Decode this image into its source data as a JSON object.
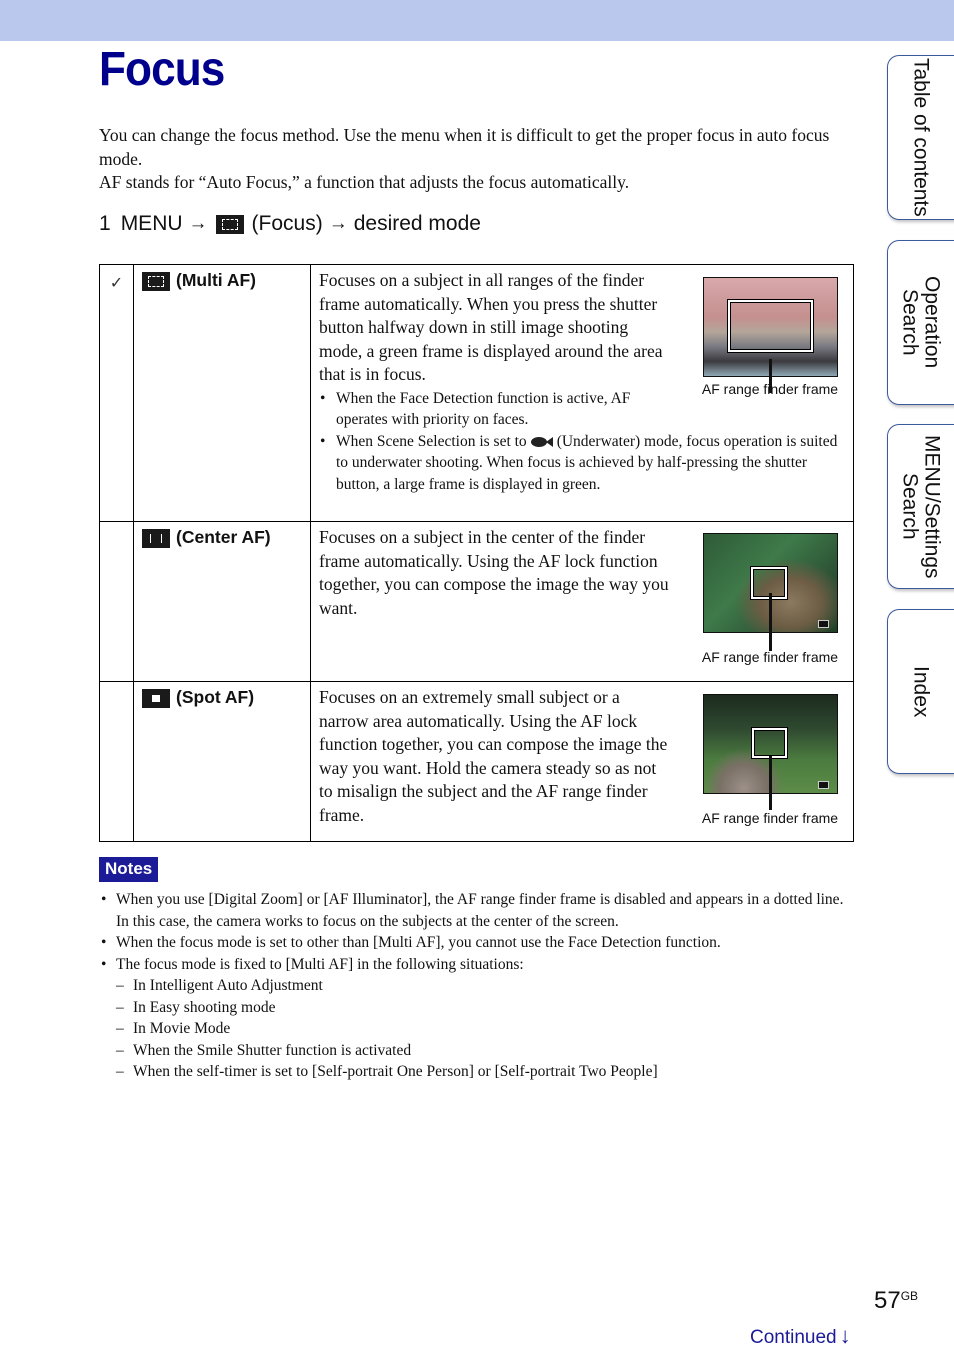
{
  "page": {
    "title": "Focus",
    "intro": [
      "You can change the focus method. Use the menu when it is difficult to get the proper focus in auto focus mode.",
      "AF stands for “Auto Focus,” a function that adjusts the focus automatically."
    ],
    "step": {
      "number": "1",
      "menu": "MENU",
      "arrow": "→",
      "icon": "focus-icon",
      "focus_label": "(Focus)",
      "target": "desired mode"
    }
  },
  "modes": [
    {
      "default_mark": "✓",
      "icon": "multi-af-icon",
      "name": "(Multi AF)",
      "description": "Focuses on a subject in all ranges of the finder frame automatically. When you press the shutter button halfway down in still image shooting mode, a green frame is displayed around the area that is in focus.",
      "bullets": [
        "When the Face Detection function is active, AF operates with priority on faces.",
        {
          "before": "When Scene Selection is set to",
          "icon": "underwater-fish-icon",
          "after": "(Underwater) mode, focus operation is suited to underwater shooting. When focus is achieved by half-pressing the shutter button, a large frame is displayed in green."
        }
      ],
      "figure_caption": "AF range finder frame"
    },
    {
      "default_mark": "",
      "icon": "center-af-icon",
      "name": "(Center AF)",
      "description": "Focuses on a subject in the center of the finder frame automatically. Using the AF lock function together, you can compose the image the way you want.",
      "figure_caption": "AF range finder frame"
    },
    {
      "default_mark": "",
      "icon": "spot-af-icon",
      "name": "(Spot AF)",
      "description": "Focuses on an extremely small subject or a narrow area automatically. Using the AF lock function together, you can compose the image the way you want. Hold the camera steady so as not to misalign the subject and the AF range finder frame.",
      "figure_caption": "AF range finder frame"
    }
  ],
  "notes": {
    "heading": "Notes",
    "items": [
      "When you use [Digital Zoom] or [AF Illuminator], the AF range finder frame is disabled and appears in a dotted line. In this case, the camera works to focus on the subjects at the center of the screen.",
      "When the focus mode is set to other than [Multi AF], you cannot use the Face Detection function.",
      "The focus mode is fixed to [Multi AF] in the following situations:"
    ],
    "situations": [
      "In Intelligent Auto Adjustment",
      "In Easy shooting mode",
      "In Movie Mode",
      "When the Smile Shutter function is activated",
      "When the self-timer is set to [Self-portrait One Person] or [Self-portrait Two People]"
    ]
  },
  "side_tabs": [
    {
      "label": "Table of contents"
    },
    {
      "label": "Operation Search"
    },
    {
      "label": "MENU/Settings Search"
    },
    {
      "label": "Index"
    }
  ],
  "footer": {
    "page_number": "57",
    "page_suffix": "GB",
    "continued": "Continued",
    "continued_arrow": "↓"
  },
  "colors": {
    "header_band": "#b9c8ec",
    "title": "#00008c",
    "notes_bg": "#1b1b98",
    "tab_border": "#3a5a9c"
  }
}
